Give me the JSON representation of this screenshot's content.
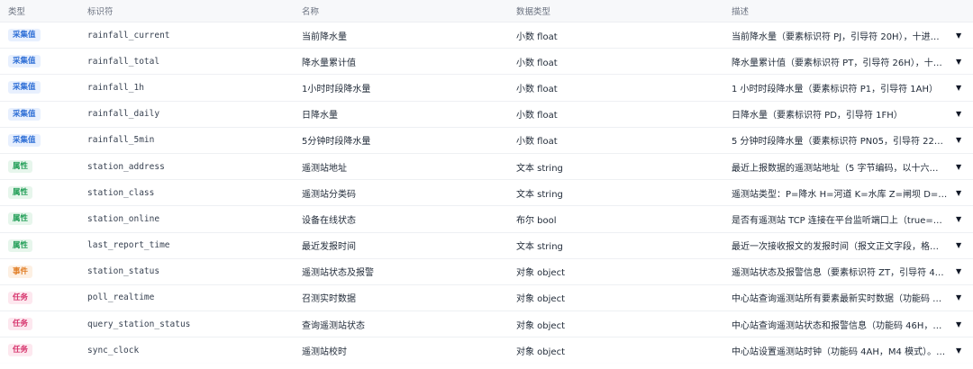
{
  "header": {
    "type": "类型",
    "identifier": "标识符",
    "name": "名称",
    "data_type": "数据类型",
    "description": "描述"
  },
  "badge_colors": {
    "采集值": {
      "bg": "#e8f0fe",
      "fg": "#2f6fd6"
    },
    "属性": {
      "bg": "#e7f6ec",
      "fg": "#1f9d55"
    },
    "事件": {
      "bg": "#fdf0e3",
      "fg": "#e07a1f"
    },
    "任务": {
      "bg": "#fde8ef",
      "fg": "#d6336c"
    }
  },
  "expand_icon": "▼",
  "rows": [
    {
      "type": "采集值",
      "id": "rainfall_current",
      "name": "当前降水量",
      "dtype": "小数 float",
      "desc": "当前降水量（要素标识符 PJ，引导符 20H），十进…"
    },
    {
      "type": "采集值",
      "id": "rainfall_total",
      "name": "降水量累计值",
      "dtype": "小数 float",
      "desc": "降水量累计值（要素标识符 PT，引导符 26H），十…"
    },
    {
      "type": "采集值",
      "id": "rainfall_1h",
      "name": "1小时时段降水量",
      "dtype": "小数 float",
      "desc": "1 小时时段降水量（要素标识符 P1，引导符 1AH）"
    },
    {
      "type": "采集值",
      "id": "rainfall_daily",
      "name": "日降水量",
      "dtype": "小数 float",
      "desc": "日降水量（要素标识符 PD，引导符 1FH）"
    },
    {
      "type": "采集值",
      "id": "rainfall_5min",
      "name": "5分钟时段降水量",
      "dtype": "小数 float",
      "desc": "5 分钟时段降水量（要素标识符 PN05，引导符 22…"
    },
    {
      "type": "属性",
      "id": "station_address",
      "name": "遥测站地址",
      "dtype": "文本 string",
      "desc": "最近上报数据的遥测站地址（5 字节编码，以十六…"
    },
    {
      "type": "属性",
      "id": "station_class",
      "name": "遥测站分类码",
      "dtype": "文本 string",
      "desc": "遥测站类型：P=降水 H=河道 K=水库 Z=闸坝 D=泵…"
    },
    {
      "type": "属性",
      "id": "station_online",
      "name": "设备在线状态",
      "dtype": "布尔 bool",
      "desc": "是否有遥测站 TCP 连接在平台监听端口上（true=…"
    },
    {
      "type": "属性",
      "id": "last_report_time",
      "name": "最近发报时间",
      "dtype": "文本 string",
      "desc": "最近一次接收报文的发报时间（报文正文字段，格…"
    },
    {
      "type": "事件",
      "id": "station_status",
      "name": "遥测站状态及报警",
      "dtype": "对象 object",
      "desc": "遥测站状态及报警信息（要素标识符 ZT，引导符 4…"
    },
    {
      "type": "任务",
      "id": "poll_realtime",
      "name": "召测实时数据",
      "dtype": "对象 object",
      "desc": "中心站查询遥测站所有要素最新实时数据（功能码 …"
    },
    {
      "type": "任务",
      "id": "query_station_status",
      "name": "查询遥测站状态",
      "dtype": "对象 object",
      "desc": "中心站查询遥测站状态和报警信息（功能码 46H，…"
    },
    {
      "type": "任务",
      "id": "sync_clock",
      "name": "遥测站校时",
      "dtype": "对象 object",
      "desc": "中心站设置遥测站时钟（功能码 4AH，M4 模式）。…"
    }
  ]
}
